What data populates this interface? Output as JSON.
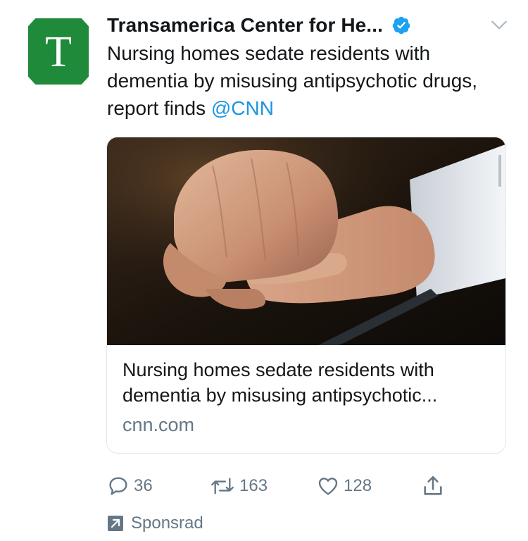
{
  "tweet": {
    "avatar_letter": "T",
    "author_name": "Transamerica Center for He...",
    "verified_icon": "verified-badge-icon",
    "menu_icon": "chevron-down-icon",
    "text": "Nursing homes sedate residents with dementia by misusing antipsychotic drugs, report finds",
    "mention": "@CNN"
  },
  "card": {
    "image_description_icon": "hands-photo",
    "title": "Nursing homes sedate residents with dementia by misusing antipsychotic...",
    "domain": "cnn.com"
  },
  "actions": {
    "reply_count": "36",
    "retweet_count": "163",
    "like_count": "128",
    "share_icon": "share-icon"
  },
  "promoted_label": "Sponsrad",
  "colors": {
    "accent": "#1b95e0",
    "avatar_bg": "#1e8a3a",
    "secondary_text": "#657786"
  }
}
